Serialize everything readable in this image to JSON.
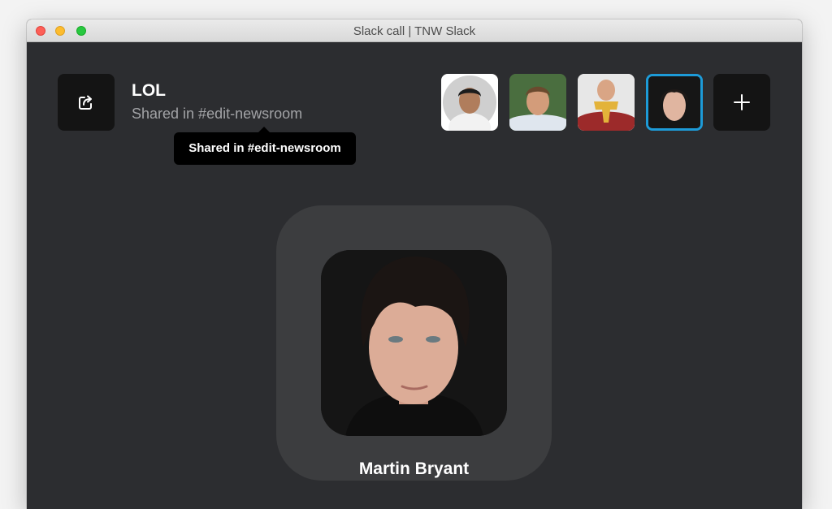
{
  "window": {
    "title": "Slack call | TNW Slack"
  },
  "call": {
    "title": "LOL",
    "subtitle": "Shared in #edit-newsroom",
    "tooltip": "Shared in #edit-newsroom",
    "share_icon": "share-icon",
    "add_icon": "plus-icon"
  },
  "participants": [
    {
      "avatar": "participant-avatar-1"
    },
    {
      "avatar": "participant-avatar-2"
    },
    {
      "avatar": "participant-avatar-3"
    },
    {
      "avatar": "participant-avatar-4",
      "active": true
    }
  ],
  "speaker": {
    "name": "Martin Bryant"
  },
  "colors": {
    "window_bg": "#2c2d30",
    "card_bg": "#3c3d3f",
    "button_bg": "#141414",
    "active_border": "#1d9bd8",
    "subtitle_text": "#a2a3a6"
  }
}
